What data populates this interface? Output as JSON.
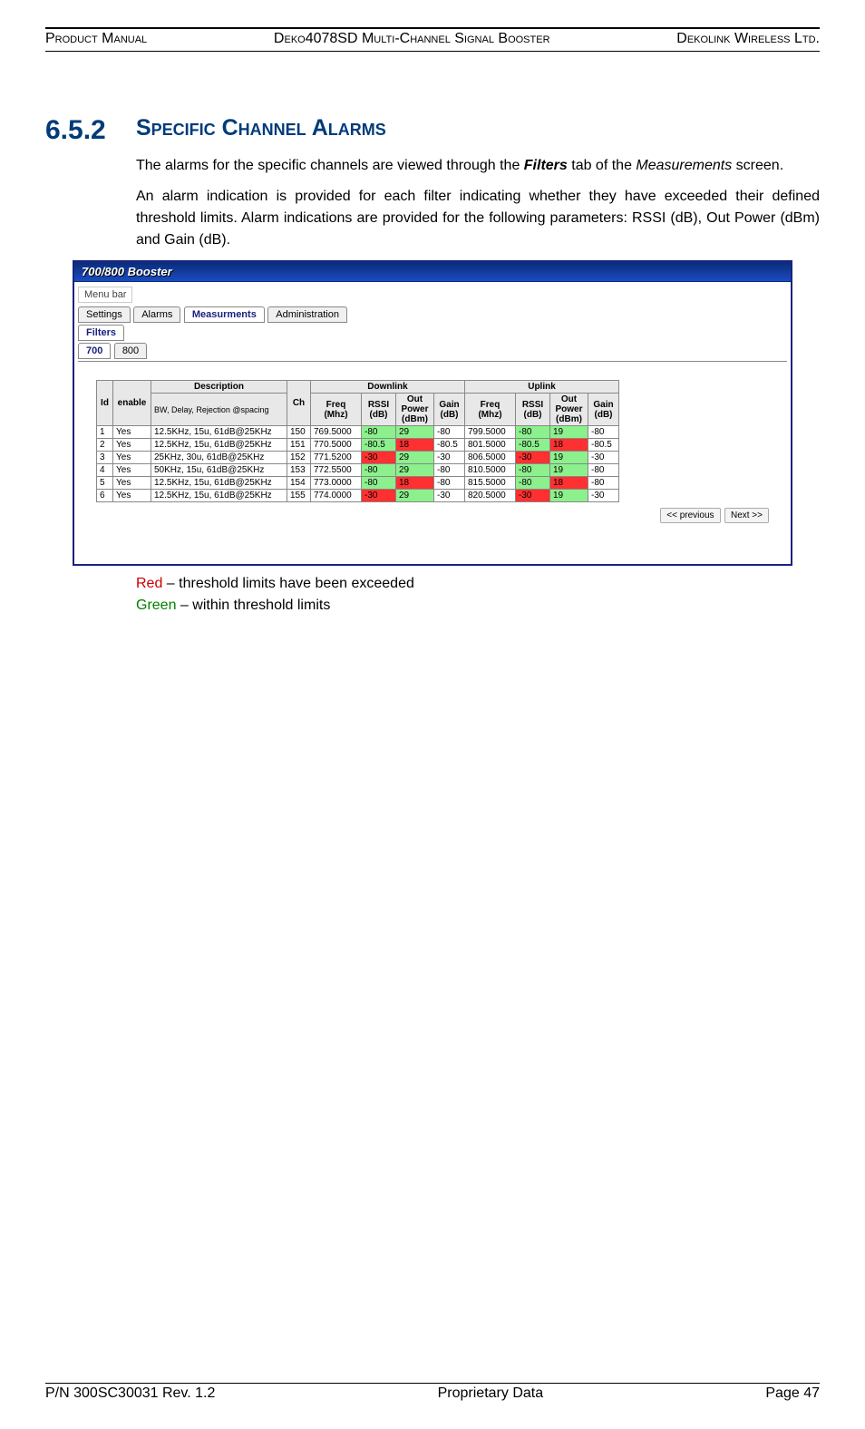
{
  "header": {
    "left": "Product Manual",
    "center": "Deko4078SD Multi-Channel Signal Booster",
    "right": "Dekolink Wireless Ltd."
  },
  "section": {
    "number": "6.5.2",
    "title": "Specific Channel Alarms"
  },
  "para1a": "The alarms for the specific channels are viewed through the ",
  "para1b": "Filters",
  "para1c": " tab of the ",
  "para1d": "Measurements",
  "para1e": " screen.",
  "para2": "An alarm indication is provided for each filter indicating whether they have exceeded their defined threshold limits. Alarm indications are provided for the following parameters: RSSI (dB), Out Power (dBm) and Gain (dB).",
  "titlebar": "700/800 Booster",
  "menubar": "Menu bar",
  "tabs": {
    "settings": "Settings",
    "alarms": "Alarms",
    "measurments": "Measurments",
    "administration": "Administration"
  },
  "subtab_filters": "Filters",
  "subtabs2": {
    "a": "700",
    "b": "800"
  },
  "table": {
    "head": {
      "id": "Id",
      "enable": "enable",
      "description": "Description",
      "desc_sub": "BW,  Delay, Rejection @spacing",
      "ch": "Ch",
      "downlink": "Downlink",
      "uplink": "Uplink",
      "freq": "Freq (Mhz)",
      "rssi": "RSSI (dB)",
      "outpower": "Out Power (dBm)",
      "gain": "Gain (dB)"
    },
    "rows": [
      {
        "id": "1",
        "enable": "Yes",
        "desc": "12.5KHz, 15u, 61dB@25KHz",
        "ch": "150",
        "dl_freq": "769.5000",
        "dl_rssi": "-80",
        "dl_rssi_c": "g",
        "dl_out": "29",
        "dl_out_c": "g",
        "dl_gain": "-80",
        "ul_freq": "799.5000",
        "ul_rssi": "-80",
        "ul_rssi_c": "g",
        "ul_out": "19",
        "ul_out_c": "g",
        "ul_gain": "-80"
      },
      {
        "id": "2",
        "enable": "Yes",
        "desc": "12.5KHz, 15u, 61dB@25KHz",
        "ch": "151",
        "dl_freq": "770.5000",
        "dl_rssi": "-80.5",
        "dl_rssi_c": "g",
        "dl_out": "18",
        "dl_out_c": "r",
        "dl_gain": "-80.5",
        "ul_freq": "801.5000",
        "ul_rssi": "-80.5",
        "ul_rssi_c": "g",
        "ul_out": "18",
        "ul_out_c": "r",
        "ul_gain": "-80.5"
      },
      {
        "id": "3",
        "enable": "Yes",
        "desc": "25KHz,    30u, 61dB@25KHz",
        "ch": "152",
        "dl_freq": "771.5200",
        "dl_rssi": "-30",
        "dl_rssi_c": "r",
        "dl_out": "29",
        "dl_out_c": "g",
        "dl_gain": "-30",
        "ul_freq": "806.5000",
        "ul_rssi": "-30",
        "ul_rssi_c": "r",
        "ul_out": "19",
        "ul_out_c": "g",
        "ul_gain": "-30"
      },
      {
        "id": "4",
        "enable": "Yes",
        "desc": "50KHz,    15u, 61dB@25KHz",
        "ch": "153",
        "dl_freq": "772.5500",
        "dl_rssi": "-80",
        "dl_rssi_c": "g",
        "dl_out": "29",
        "dl_out_c": "g",
        "dl_gain": "-80",
        "ul_freq": "810.5000",
        "ul_rssi": "-80",
        "ul_rssi_c": "g",
        "ul_out": "19",
        "ul_out_c": "g",
        "ul_gain": "-80"
      },
      {
        "id": "5",
        "enable": "Yes",
        "desc": "12.5KHz, 15u, 61dB@25KHz",
        "ch": "154",
        "dl_freq": "773.0000",
        "dl_rssi": "-80",
        "dl_rssi_c": "g",
        "dl_out": "18",
        "dl_out_c": "r",
        "dl_gain": "-80",
        "ul_freq": "815.5000",
        "ul_rssi": "-80",
        "ul_rssi_c": "g",
        "ul_out": "18",
        "ul_out_c": "r",
        "ul_gain": "-80"
      },
      {
        "id": "6",
        "enable": "Yes",
        "desc": "12.5KHz, 15u, 61dB@25KHz",
        "ch": "155",
        "dl_freq": "774.0000",
        "dl_rssi": "-30",
        "dl_rssi_c": "r",
        "dl_out": "29",
        "dl_out_c": "g",
        "dl_gain": "-30",
        "ul_freq": "820.5000",
        "ul_rssi": "-30",
        "ul_rssi_c": "r",
        "ul_out": "19",
        "ul_out_c": "g",
        "ul_gain": "-30"
      }
    ]
  },
  "buttons": {
    "prev": "<< previous",
    "next": "Next  >>"
  },
  "legend": {
    "red_label": "Red",
    "red_text": " – threshold limits have been exceeded",
    "green_label": "Green",
    "green_text": " – within threshold limits"
  },
  "footer": {
    "left": "P/N 300SC30031 Rev. 1.2",
    "center": "Proprietary Data",
    "right": "Page 47"
  }
}
